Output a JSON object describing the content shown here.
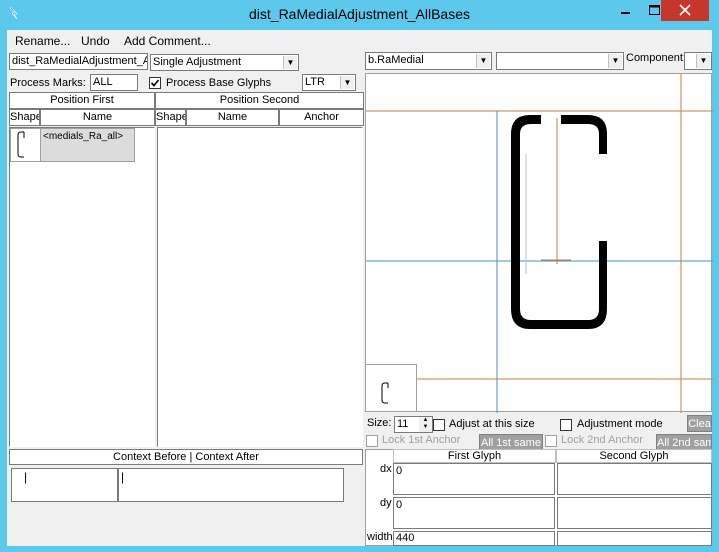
{
  "window": {
    "title": "dist_RaMedialAdjustment_AllBases",
    "controls": {
      "minimize": "▁",
      "maximize": "□",
      "close": "✕"
    }
  },
  "menu": [
    "Rename...",
    "Undo",
    "Add Comment..."
  ],
  "lookup": {
    "name_value": "dist_RaMedialAdjustment_Al",
    "type_value": "Single Adjustment",
    "process_marks_label": "Process Marks:",
    "process_marks_value": "ALL",
    "process_base_glyphs_label": "Process Base Glyphs",
    "process_base_glyphs_checked": true,
    "direction_value": "LTR"
  },
  "position_first": {
    "header": "Position First",
    "columns": [
      "Shape",
      "Name"
    ],
    "rows": [
      {
        "name": "<medials_Ra_all>"
      }
    ]
  },
  "position_second": {
    "header": "Position Second",
    "columns": [
      "Shape",
      "Name",
      "Anchor"
    ]
  },
  "context": {
    "header": "Context Before | Context After",
    "before_value": "|",
    "after_value": "|"
  },
  "preview": {
    "glyph_value": "b.RaMedial",
    "second_value": "",
    "component_label": "Component:",
    "component_value": ""
  },
  "controls": {
    "size_label": "Size:",
    "size_value": "11",
    "adjust_label": "Adjust at this size",
    "adjust_mode_label": "Adjustment mode",
    "clear_label": "Clea",
    "lock1_label": "Lock 1st Anchor",
    "all1_label": "All 1st same",
    "lock2_label": "Lock 2nd Anchor",
    "all2_label": "All 2nd sam"
  },
  "glyph_table": {
    "first_header": "First Glyph",
    "second_header": "Second Glyph",
    "rows": [
      {
        "label": "dx",
        "first": "0",
        "second": ""
      },
      {
        "label": "dy",
        "first": "0",
        "second": ""
      },
      {
        "label": "width",
        "first": "440",
        "second": ""
      }
    ]
  }
}
